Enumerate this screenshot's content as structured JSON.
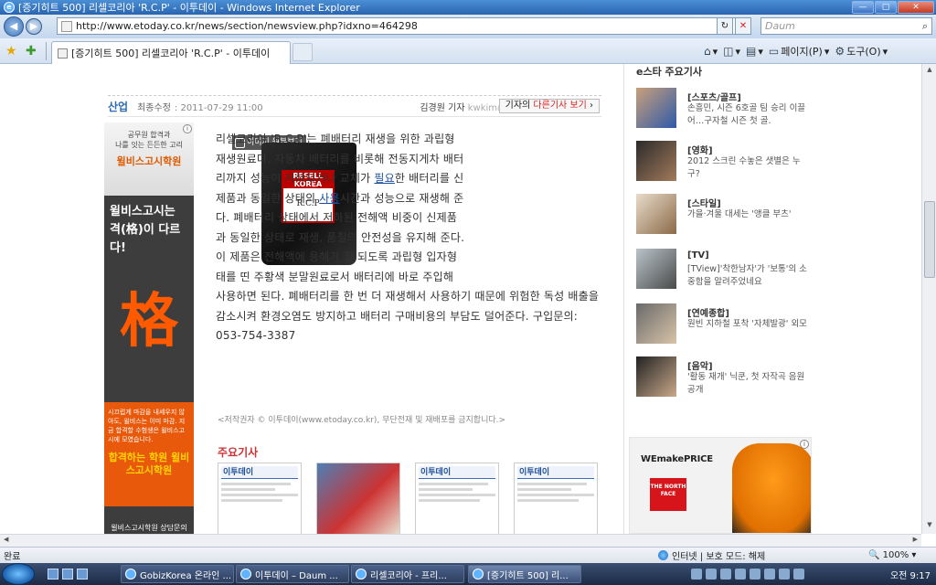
{
  "window": {
    "title": "[증기히트 500] 리셀코리아 'R.C.P' - 이투데이 - Windows Internet Explorer",
    "url": "http://www.etoday.co.kr/news/section/newsview.php?idxno=464298",
    "search_placeholder": "Daum"
  },
  "tabs": {
    "active_label": "[증기히트 500] 리셀코리아 'R.C.P' - 이투데이"
  },
  "commandbar": {
    "page": "페이지(P)",
    "tools": "도구(O)"
  },
  "article": {
    "section": "산업",
    "updated_label": "최종수정",
    "updated": ": 2011-07-29 11:00",
    "reporter": "김경원 기자",
    "email": "kwkim@",
    "more_button_pre": "기자의 ",
    "more_button_red": "다른기사 보기",
    "more_button_post": " ›",
    "view_original": "이미지 원본보기",
    "product_brand": "RESELL KOREA",
    "product_name": "R.C.P",
    "body_1": "리셀코리아 'R.C.P'는 폐배터리 재생을 위한 과립형 재생원료다. 자동차 배터리를 비롯해 전동지게차 배터리까지 성능이 저하되거나 교체가 ",
    "link_1": "필요",
    "body_2": "한 배터리를 신제품과 동일한 상태의 ",
    "link_2": "사용",
    "body_3": "시간과 성능으로 재생해 준다. 폐배터리 상태에서 저하된 전해액 비중이 신제품과 동일한 상태로 재생, 품질의 안전성을 유지해 준다. 이 제품은 전해액에 용해가 잘 되도록 과립형 입자형태를 띤 주황색 분말원료로서 배터리에 바로 주입해 사용하면 된다. 폐배터리를 한 번 더 재생해서 사용하기 때문에 위험한 독성 배출을 감소시켜 환경오염도 방지하고 배터리 구매비용의 부담도 덜어준다. 구입문의: 053-754-3387",
    "copyright": "<저작권자 © 이투데이(www.etoday.co.kr), 무단전재 및 재배포를 금지합니다.>",
    "main_news_heading": "주요기사",
    "thumb_brand": "이투데이"
  },
  "left_ad": {
    "line1": "공무원 합격과",
    "line2": "나를 잇는 든든한 고리",
    "brand": "윌비스고시학원",
    "headline": "윌비스고시는 격(格)이 다르다!",
    "big_char": "格",
    "small_copy": "시끄럽게 마감을 내세우지 않아도, 윌비스는 이미 마감. 지금 합격할 수험생은 윌비스고시에 모였습니다.",
    "call": "합격하는 학원 윌비스고시학원",
    "bottom": "윌비스고시학원 상담문의"
  },
  "sidebar": {
    "heading": "e스타 주요기사",
    "items": [
      {
        "category": "[스포츠/골프]",
        "text": "손흥민, 시즌 6호골 팀 승리 이끌어…구자철 시즌 첫 골."
      },
      {
        "category": "[영화]",
        "text": "2012 스크린 수놓은 샛별은 누구?"
      },
      {
        "category": "[스타일]",
        "text": "가을·겨울 대세는 '앵클 부츠'"
      },
      {
        "category": "[TV]",
        "text": "[TView]'착한남자'가 '보통'의 소중함을 알려주었네요"
      },
      {
        "category": "[연예종합]",
        "text": "원빈 지하철 포착 '자체발광' 외모"
      },
      {
        "category": "[음악]",
        "text": "'활동 재개' 닉쿤, 첫 자작곡 음원 공개"
      }
    ]
  },
  "right_ad": {
    "brand": "WEmakePRICE",
    "logo": "THE NORTH FACE"
  },
  "statusbar": {
    "status": "완료",
    "zone": "인터넷 | 보호 모드: 해제",
    "zoom": "100%"
  },
  "taskbar": {
    "buttons": [
      "GobizKorea 온라인 ...",
      "이투데이 – Daum ...",
      "리셀코리아 - 프리...",
      "[증기히트 500] 리..."
    ],
    "clock": "오전 9:17"
  },
  "colors": {
    "accent_blue": "#2a6bb5",
    "heading_red": "#cc3333",
    "ad_orange": "#e8590c"
  }
}
